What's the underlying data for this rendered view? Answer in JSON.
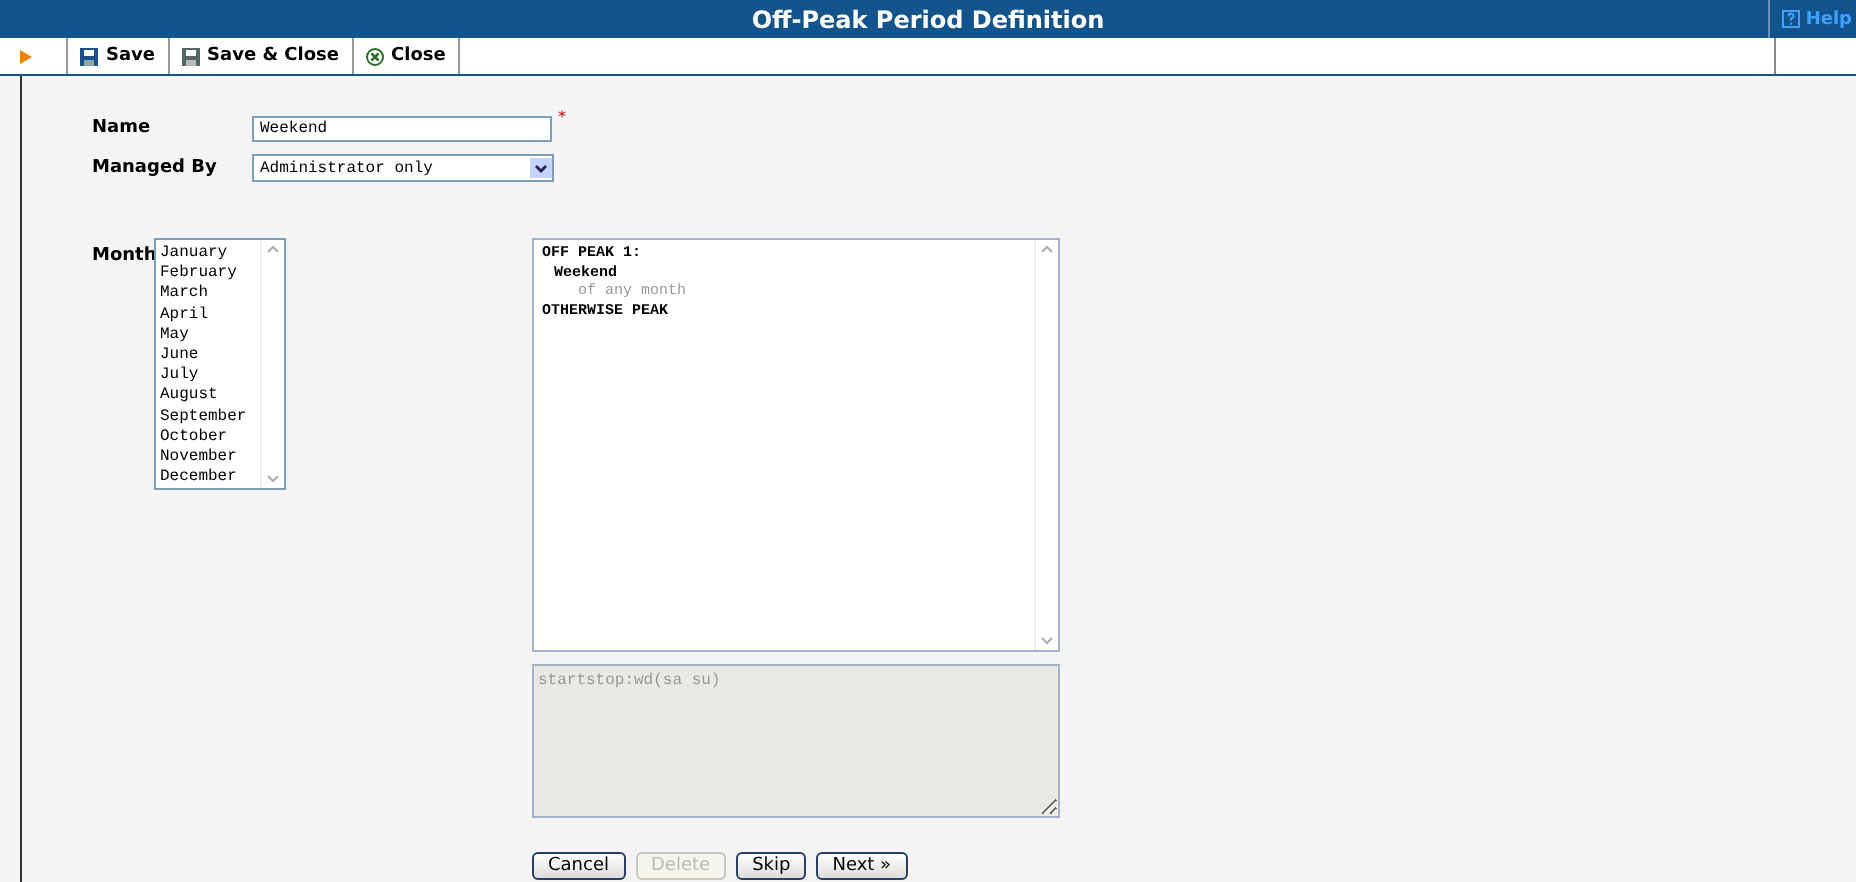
{
  "window": {
    "title": "Off-Peak Period Definition",
    "help": "Help"
  },
  "toolbar": [
    {
      "label": "Save",
      "kind": "save"
    },
    {
      "label": "Save & Close",
      "kind": "save-close"
    },
    {
      "label": "Close",
      "kind": "close"
    }
  ],
  "form": {
    "name": {
      "label": "Name",
      "value": "Weekend",
      "required_mark": "*"
    },
    "managed_by": {
      "label": "Managed By",
      "value": "Administrator only"
    },
    "month": {
      "label": "Month",
      "options": [
        "January",
        "February",
        "March",
        "April",
        "May",
        "June",
        "July",
        "August",
        "September",
        "October",
        "November",
        "December"
      ]
    }
  },
  "preview": [
    {
      "text": "OFF PEAK 1:",
      "kind": "rule"
    },
    {
      "text": "Weekend",
      "kind": "condition"
    },
    {
      "text": "of any month",
      "kind": "detail"
    },
    {
      "text": "OTHERWISE PEAK",
      "kind": "rule"
    }
  ],
  "expression": {
    "value": "startstop:wd(sa su)"
  },
  "buttons": [
    {
      "label": "Cancel",
      "disabled": false
    },
    {
      "label": "Delete",
      "disabled": true
    },
    {
      "label": "Skip",
      "disabled": false
    },
    {
      "label": "Next »",
      "disabled": false
    }
  ]
}
